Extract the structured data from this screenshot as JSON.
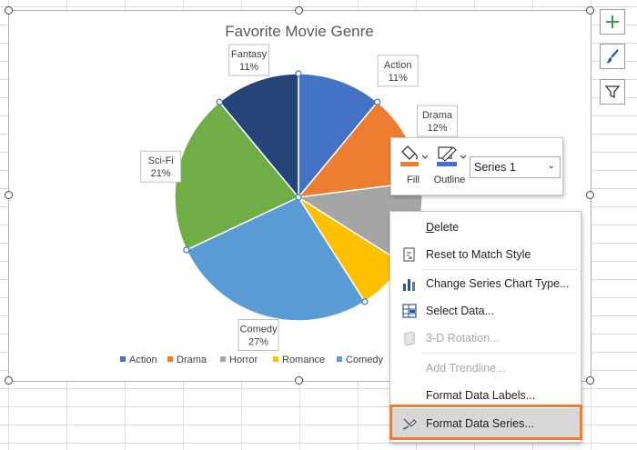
{
  "chart_data": {
    "type": "pie",
    "title": "Favorite Movie Genre",
    "series_name": "Series 1",
    "slices": [
      {
        "label": "Action",
        "value": 11,
        "color": "#4472C4",
        "data_label": "11%"
      },
      {
        "label": "Drama",
        "value": 12,
        "color": "#ED7D31",
        "data_label": "12%"
      },
      {
        "label": "Horror",
        "value": 11,
        "color": "#A5A5A5",
        "data_label": ""
      },
      {
        "label": "Romance",
        "value": 7,
        "color": "#FFC000",
        "data_label": ""
      },
      {
        "label": "Comedy",
        "value": 27,
        "color": "#5B9BD5",
        "data_label": "27%"
      },
      {
        "label": "Sci-Fi",
        "value": 21,
        "color": "#70AD47",
        "data_label": "21%"
      },
      {
        "label": "Fantasy",
        "value": 11,
        "color": "#264478",
        "data_label": "11%"
      }
    ],
    "legend": [
      "Action",
      "Drama",
      "Horror",
      "Romance",
      "Comedy"
    ],
    "legend_position": "bottom"
  },
  "side_buttons": {
    "add": "chart-elements",
    "style": "chart-styles",
    "filter": "chart-filters"
  },
  "toolbar": {
    "fill_label": "Fill",
    "outline_label": "Outline",
    "series_value": "Series 1"
  },
  "menu": {
    "delete": "Delete",
    "reset": "Reset to Match Style",
    "change_type": "Change Series Chart Type...",
    "select_data": "Select Data...",
    "rotation": "3-D Rotation...",
    "trendline": "Add Trendline...",
    "format_labels": "Format Data Labels...",
    "format_series": "Format Data Series..."
  },
  "colors": {
    "accent": "#f07d30",
    "fill_color": "#ED7D31",
    "outline_color": "#4472C4"
  }
}
